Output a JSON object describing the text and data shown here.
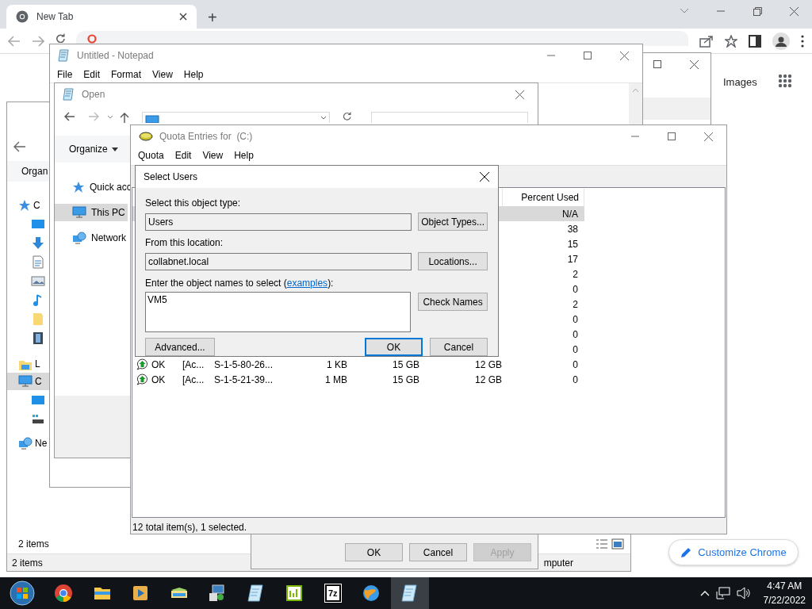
{
  "browser": {
    "tab": {
      "title": "New Tab",
      "selected": true
    },
    "new_tab_button": "+",
    "links": [
      "Images"
    ],
    "customize_button": "Customize Chrome"
  },
  "explorer": {
    "toolbar_button": "Organ",
    "nav": [
      {
        "label": "C",
        "selected": false
      },
      {
        "label": "L",
        "selected": false
      },
      {
        "label": "C",
        "selected": true
      },
      {
        "label": "Ne",
        "selected": false
      }
    ],
    "item_count": "2 items",
    "status_bar": {
      "left": "2 items",
      "right": "mputer"
    }
  },
  "notepad": {
    "title": "Untitled - Notepad",
    "menu": [
      "File",
      "Edit",
      "Format",
      "View",
      "Help"
    ]
  },
  "open_dialog": {
    "title": "Open",
    "toolbar_button": "Organize",
    "nav": [
      {
        "label": "Quick acc",
        "selected": false
      },
      {
        "label": "This PC",
        "selected": true
      },
      {
        "label": "Network",
        "selected": false
      }
    ]
  },
  "properties_dialog": {
    "buttons": [
      {
        "label": "OK",
        "disabled": false
      },
      {
        "label": "Cancel",
        "disabled": false
      },
      {
        "label": "Apply",
        "disabled": true
      }
    ]
  },
  "quota_window": {
    "title": "Quota Entries for  (C:)",
    "menu": [
      "Quota",
      "Edit",
      "View",
      "Help"
    ],
    "columns": [
      "Percent Used"
    ],
    "rows": [
      {
        "percent": "N/A",
        "selected": true
      },
      {
        "percent": "38",
        "selected": false
      },
      {
        "percent": "15",
        "selected": false
      },
      {
        "percent": "17",
        "selected": false
      },
      {
        "percent": "2",
        "selected": false
      },
      {
        "percent": "0",
        "selected": false
      },
      {
        "percent": "2",
        "selected": false
      },
      {
        "percent": "0",
        "selected": false
      },
      {
        "percent": "0",
        "selected": false
      },
      {
        "percent": "0",
        "selected": false
      },
      {
        "status": "OK",
        "name": "[Ac...",
        "logon": "S-1-5-80-26...",
        "used": "1 KB",
        "limit": "15 GB",
        "warning": "12 GB",
        "percent": "0",
        "selected": false
      },
      {
        "status": "OK",
        "name": "[Ac...",
        "logon": "S-1-5-21-39...",
        "used": "1 MB",
        "limit": "15 GB",
        "warning": "12 GB",
        "percent": "0",
        "selected": false
      }
    ],
    "status_bar": "12 total item(s), 1 selected."
  },
  "select_users": {
    "title": "Select Users",
    "object_type": {
      "label": "Select this object type:",
      "value": "Users",
      "button": "Object Types..."
    },
    "location": {
      "label": "From this location:",
      "value": "collabnet.local",
      "button": "Locations..."
    },
    "names": {
      "label_before": "Enter the object names to select (",
      "link": "examples",
      "label_after": "):",
      "value": "VM5",
      "button": "Check Names"
    },
    "buttons": [
      {
        "label": "Advanced...",
        "default": false
      },
      {
        "label": "OK",
        "default": true
      },
      {
        "label": "Cancel",
        "default": false
      }
    ]
  },
  "taskbar": {
    "apps": [
      {
        "kind": "chrome",
        "active": false
      },
      {
        "kind": "folder",
        "active": false
      },
      {
        "kind": "media",
        "active": false
      },
      {
        "kind": "files",
        "active": false
      },
      {
        "kind": "control",
        "active": false
      },
      {
        "kind": "notepad",
        "active": false
      },
      {
        "kind": "sheet",
        "active": false
      },
      {
        "kind": "archive",
        "label": "7z",
        "active": false
      },
      {
        "kind": "globe",
        "active": false
      },
      {
        "kind": "notepad",
        "active": true
      }
    ],
    "clock": {
      "time": "4:47 AM",
      "date": "7/22/2022"
    }
  }
}
